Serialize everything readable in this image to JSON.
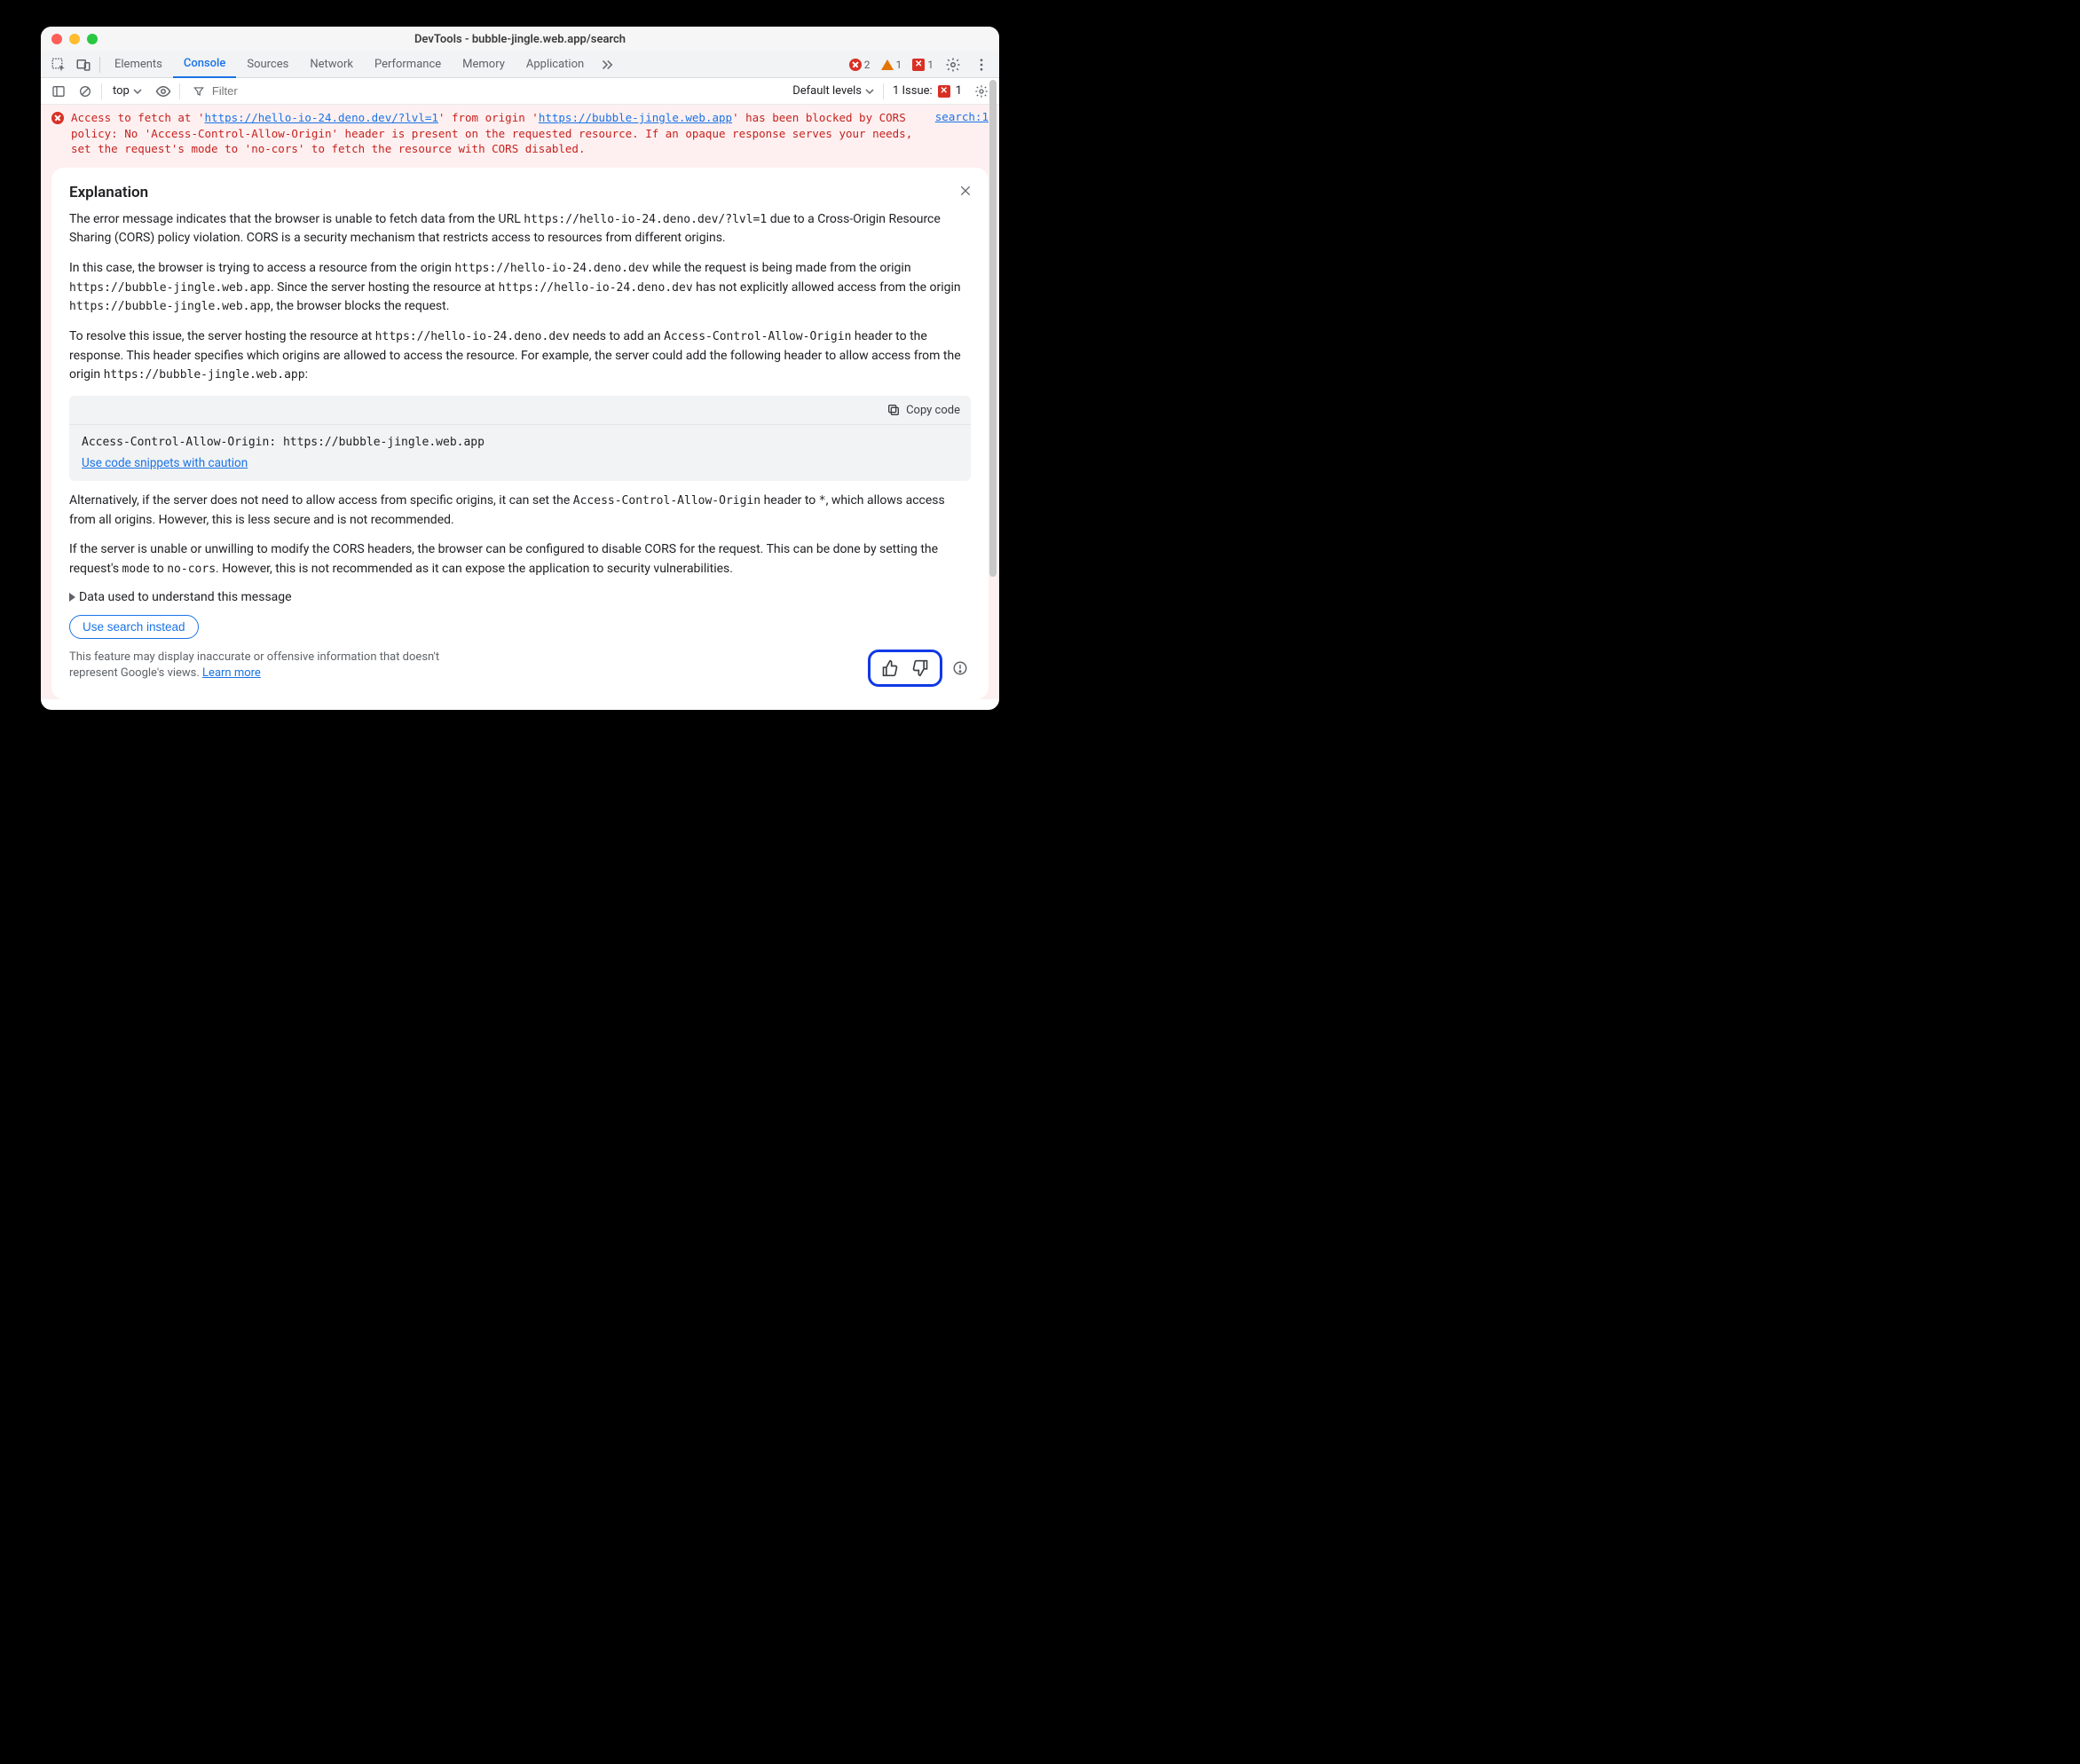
{
  "window": {
    "title": "DevTools - bubble-jingle.web.app/search"
  },
  "tabs": {
    "items": [
      "Elements",
      "Console",
      "Sources",
      "Network",
      "Performance",
      "Memory",
      "Application"
    ],
    "active_index": 1
  },
  "counters": {
    "errors": "2",
    "warnings": "1",
    "blocked": "1"
  },
  "subbar": {
    "context": "top",
    "filter_placeholder": "Filter",
    "levels": "Default levels",
    "issue_label": "1 Issue:",
    "issue_count": "1"
  },
  "error": {
    "pre1": "Access to fetch at '",
    "url1": "https://hello-io-24.deno.dev/?lvl=1",
    "mid1": "' from origin '",
    "url2": "https://bubble-jingle.web.app",
    "post": "' has been blocked by CORS policy: No 'Access-Control-Allow-Origin' header is present on the requested resource. If an opaque response serves your needs, set the request's mode to 'no-cors' to fetch the resource with CORS disabled.",
    "source": "search:1"
  },
  "explain": {
    "title": "Explanation",
    "p1_a": "The error message indicates that the browser is unable to fetch data from the URL ",
    "p1_b": "https://hello-io-24.deno.dev/?lvl=1",
    "p1_c": " due to a Cross-Origin Resource Sharing (CORS) policy violation. CORS is a security mechanism that restricts access to resources from different origins.",
    "p2_a": "In this case, the browser is trying to access a resource from the origin ",
    "p2_b": "https://hello-io-24.deno.dev",
    "p2_c": " while the request is being made from the origin ",
    "p2_d": "https://bubble-jingle.web.app",
    "p2_e": ". Since the server hosting the resource at ",
    "p2_f": "https://hello-io-24.deno.dev",
    "p2_g": " has not explicitly allowed access from the origin ",
    "p2_h": "https://bubble-jingle.web.app",
    "p2_i": ", the browser blocks the request.",
    "p3_a": "To resolve this issue, the server hosting the resource at ",
    "p3_b": "https://hello-io-24.deno.dev",
    "p3_c": " needs to add an ",
    "p3_d": "Access-Control-Allow-Origin",
    "p3_e": " header to the response. This header specifies which origins are allowed to access the resource. For example, the server could add the following header to allow access from the origin ",
    "p3_f": "https://bubble-jingle.web.app",
    "p3_g": ":",
    "copy_label": "Copy code",
    "code": "Access-Control-Allow-Origin: https://bubble-jingle.web.app",
    "caution": "Use code snippets with caution",
    "p4_a": "Alternatively, if the server does not need to allow access from specific origins, it can set the ",
    "p4_b": "Access-Control-Allow-Origin",
    "p4_c": " header to ",
    "p4_d": "*",
    "p4_e": ", which allows access from all origins. However, this is less secure and is not recommended.",
    "p5_a": "If the server is unable or unwilling to modify the CORS headers, the browser can be configured to disable CORS for the request. This can be done by setting the request's ",
    "p5_b": "mode",
    "p5_c": " to ",
    "p5_d": "no-cors",
    "p5_e": ". However, this is not recommended as it can expose the application to security vulnerabilities.",
    "details": "Data used to understand this message",
    "search_btn": "Use search instead",
    "disclaimer": "This feature may display inaccurate or offensive information that doesn't represent Google's views. ",
    "learn_more": "Learn more"
  }
}
